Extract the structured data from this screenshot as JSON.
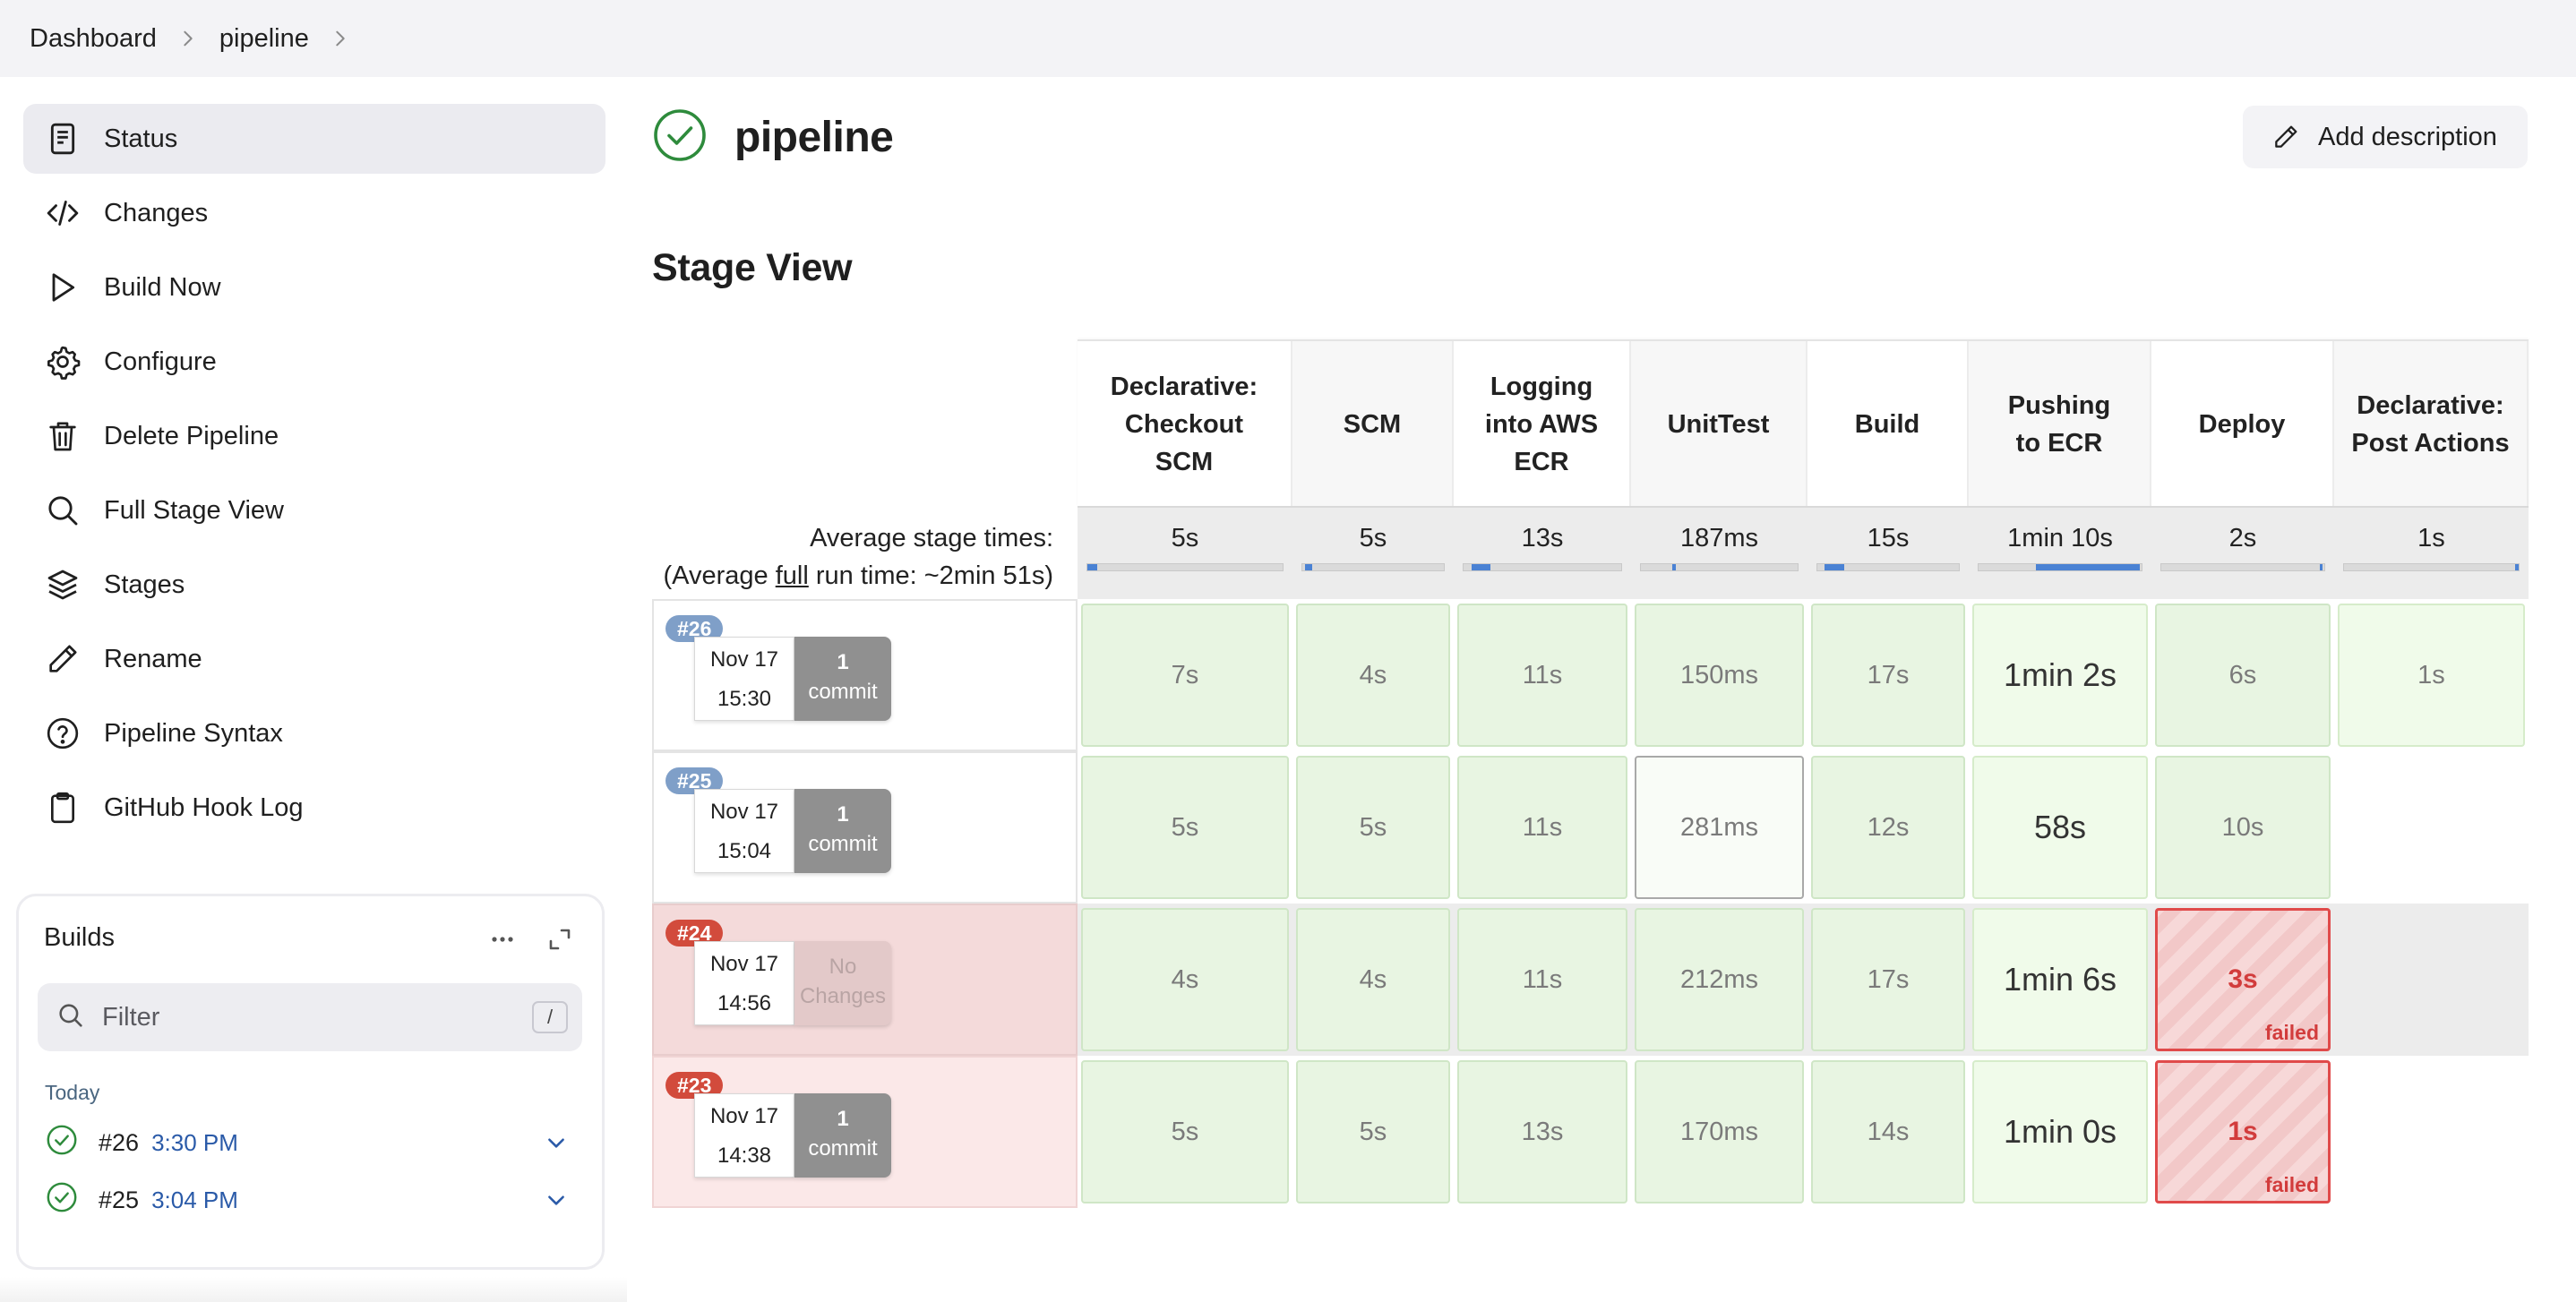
{
  "breadcrumb": {
    "items": [
      "Dashboard",
      "pipeline"
    ]
  },
  "sidebar": {
    "items": [
      {
        "label": "Status",
        "icon": "document-icon",
        "active": true
      },
      {
        "label": "Changes",
        "icon": "code-icon"
      },
      {
        "label": "Build Now",
        "icon": "play-icon"
      },
      {
        "label": "Configure",
        "icon": "gear-icon"
      },
      {
        "label": "Delete Pipeline",
        "icon": "trash-icon"
      },
      {
        "label": "Full Stage View",
        "icon": "search-icon"
      },
      {
        "label": "Stages",
        "icon": "layers-icon"
      },
      {
        "label": "Rename",
        "icon": "pencil-icon"
      },
      {
        "label": "Pipeline Syntax",
        "icon": "help-circle-icon"
      },
      {
        "label": "GitHub Hook Log",
        "icon": "clipboard-icon"
      }
    ]
  },
  "builds": {
    "title": "Builds",
    "filter_placeholder": "Filter",
    "filter_shortcut": "/",
    "group_label": "Today",
    "items": [
      {
        "number": "#26",
        "time": "3:30 PM",
        "status": "success"
      },
      {
        "number": "#25",
        "time": "3:04 PM",
        "status": "success"
      }
    ]
  },
  "page": {
    "title": "pipeline",
    "status": "success",
    "add_description": "Add description",
    "section_title": "Stage View"
  },
  "stage_view": {
    "avg_label_line1": "Average stage times:",
    "avg_label_pre": "(Average ",
    "avg_label_link": "full",
    "avg_label_post": " run time: ~2min 51s)",
    "stages": [
      {
        "name": "Declarative: Checkout SCM",
        "avg": "5s",
        "bar_fraction": 0.05
      },
      {
        "name": "SCM",
        "avg": "5s",
        "bar_fraction": 0.05
      },
      {
        "name": "Logging into AWS ECR",
        "avg": "13s",
        "bar_fraction": 0.12
      },
      {
        "name": "UnitTest",
        "avg": "187ms",
        "bar_fraction": 0.01
      },
      {
        "name": "Build",
        "avg": "15s",
        "bar_fraction": 0.14
      },
      {
        "name": "Pushing to ECR",
        "avg": "1min 10s",
        "bar_fraction": 0.64
      },
      {
        "name": "Deploy",
        "avg": "2s",
        "bar_fraction": 0.02
      },
      {
        "name": "Declarative: Post Actions",
        "avg": "1s",
        "bar_fraction": 0.01
      }
    ],
    "runs": [
      {
        "badge": "#26",
        "status": "success",
        "date": "Nov 17",
        "time": "15:30",
        "commit_count": "1",
        "commit_label": "commit",
        "cells": [
          "7s",
          "4s",
          "11s",
          "150ms",
          "17s",
          "1min 2s",
          "6s",
          "1s"
        ]
      },
      {
        "badge": "#25",
        "status": "success",
        "date": "Nov 17",
        "time": "15:04",
        "commit_count": "1",
        "commit_label": "commit",
        "cells": [
          "5s",
          "5s",
          "11s",
          "281ms",
          "12s",
          "58s",
          "10s",
          ""
        ]
      },
      {
        "badge": "#24",
        "status": "failed",
        "date": "Nov 17",
        "time": "14:56",
        "commit_count": "No",
        "commit_label": "Changes",
        "cells": [
          "4s",
          "4s",
          "11s",
          "212ms",
          "17s",
          "1min 6s",
          "3s",
          ""
        ],
        "failed_label": "failed"
      },
      {
        "badge": "#23",
        "status": "failed",
        "date": "Nov 17",
        "time": "14:38",
        "commit_count": "1",
        "commit_label": "commit",
        "cells": [
          "5s",
          "5s",
          "13s",
          "170ms",
          "14s",
          "1min 0s",
          "1s",
          ""
        ],
        "failed_label": "failed"
      }
    ]
  },
  "colors": {
    "success_green": "#2e8b3c",
    "failed_red": "#d23c3c",
    "link_blue": "#2a5aa8",
    "stage_ok": "#e8f5e2"
  }
}
